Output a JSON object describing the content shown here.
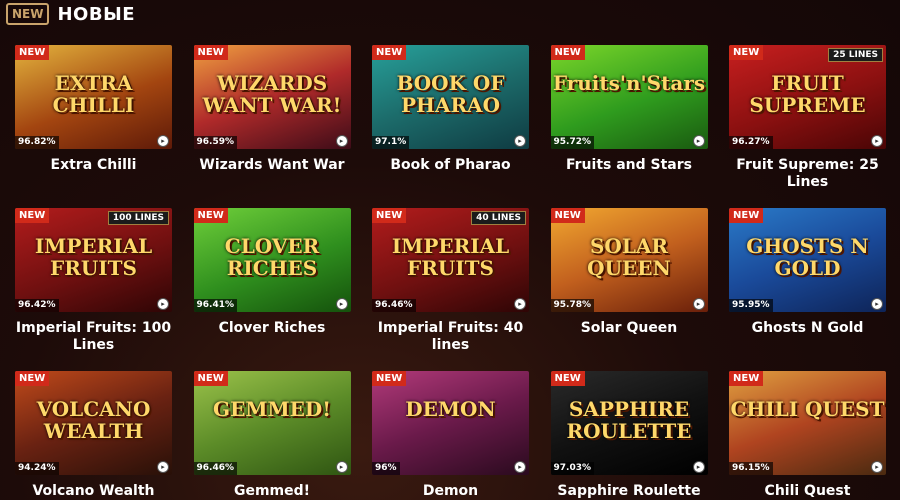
{
  "header": {
    "badge": "NEW",
    "title": "НОВЫЕ"
  },
  "games": [
    {
      "name": "Extra Chilli",
      "art": "EXTRA CHILLI",
      "rtp": "96.82%",
      "new": "NEW",
      "lines": "",
      "bg": "linear-gradient(160deg,#e3b33d,#a34510 55%,#5e1a08)"
    },
    {
      "name": "Wizards Want War",
      "art": "WIZARDS WANT WAR!",
      "rtp": "96.59%",
      "new": "NEW",
      "lines": "",
      "bg": "linear-gradient(160deg,#f0a040,#b02a2a 50%,#3d0c18)"
    },
    {
      "name": "Book of Pharao",
      "art": "BOOK OF PHARAO",
      "rtp": "97.1%",
      "new": "NEW",
      "lines": "",
      "bg": "linear-gradient(160deg,#27a09a,#1c6b6a 50%,#0f3b42)"
    },
    {
      "name": "Fruits and Stars",
      "art": "Fruits'n'Stars",
      "rtp": "95.72%",
      "new": "NEW",
      "lines": "",
      "bg": "linear-gradient(160deg,#7bd62a,#2f9c1e 55%,#1a5a10)"
    },
    {
      "name": "Fruit Supreme: 25 Lines",
      "art": "FRUIT SUPREME",
      "rtp": "96.27%",
      "new": "NEW",
      "lines": "25 LINES",
      "bg": "linear-gradient(160deg,#c81f1f,#8a1010 55%,#4a0505)"
    },
    {
      "name": "Imperial Fruits: 100 Lines",
      "art": "IMPERIAL FRUITS",
      "rtp": "96.42%",
      "new": "NEW",
      "lines": "100 LINES",
      "bg": "linear-gradient(160deg,#b31c1c,#701010 55%,#2e0505)"
    },
    {
      "name": "Clover Riches",
      "art": "CLOVER RICHES",
      "rtp": "96.41%",
      "new": "NEW",
      "lines": "",
      "bg": "linear-gradient(160deg,#6fcf3a,#2f8f1e 55%,#15520c)"
    },
    {
      "name": "Imperial Fruits: 40 lines",
      "art": "IMPERIAL FRUITS",
      "rtp": "96.46%",
      "new": "NEW",
      "lines": "40 LINES",
      "bg": "linear-gradient(160deg,#b31c1c,#701010 55%,#2e0505)"
    },
    {
      "name": "Solar Queen",
      "art": "SOLAR QUEEN",
      "rtp": "95.78%",
      "new": "NEW",
      "lines": "",
      "bg": "linear-gradient(160deg,#f2a830,#c2601e 50%,#6a1f0a)"
    },
    {
      "name": "Ghosts N Gold",
      "art": "GHOSTS N GOLD",
      "rtp": "95.95%",
      "new": "NEW",
      "lines": "",
      "bg": "linear-gradient(160deg,#2a7ac8,#1a4a9a 50%,#0e2458)"
    },
    {
      "name": "Volcano Wealth",
      "art": "VOLCANO WEALTH",
      "rtp": "94.24%",
      "new": "NEW",
      "lines": "",
      "bg": "linear-gradient(160deg,#c04a1a,#6a2212 50%,#281008)"
    },
    {
      "name": "Gemmed!",
      "art": "GEMMED!",
      "rtp": "96.46%",
      "new": "NEW",
      "lines": "",
      "bg": "linear-gradient(160deg,#9bc24a,#5c8c28 50%,#2f5512)"
    },
    {
      "name": "Demon",
      "art": "DEMON",
      "rtp": "96%",
      "new": "NEW",
      "lines": "",
      "bg": "linear-gradient(160deg,#b23a7a,#6a1a4a 50%,#2a0a1e)"
    },
    {
      "name": "Sapphire Roulette",
      "art": "SAPPHIRE ROULETTE",
      "rtp": "97.03%",
      "new": "NEW",
      "lines": "",
      "bg": "linear-gradient(160deg,#2a2a2a,#111 50%,#000)"
    },
    {
      "name": "Chili Quest",
      "art": "CHILI QUEST",
      "rtp": "96.15%",
      "new": "NEW",
      "lines": "",
      "bg": "linear-gradient(160deg,#e0a040,#b04420 50%,#4a2a10)"
    }
  ]
}
